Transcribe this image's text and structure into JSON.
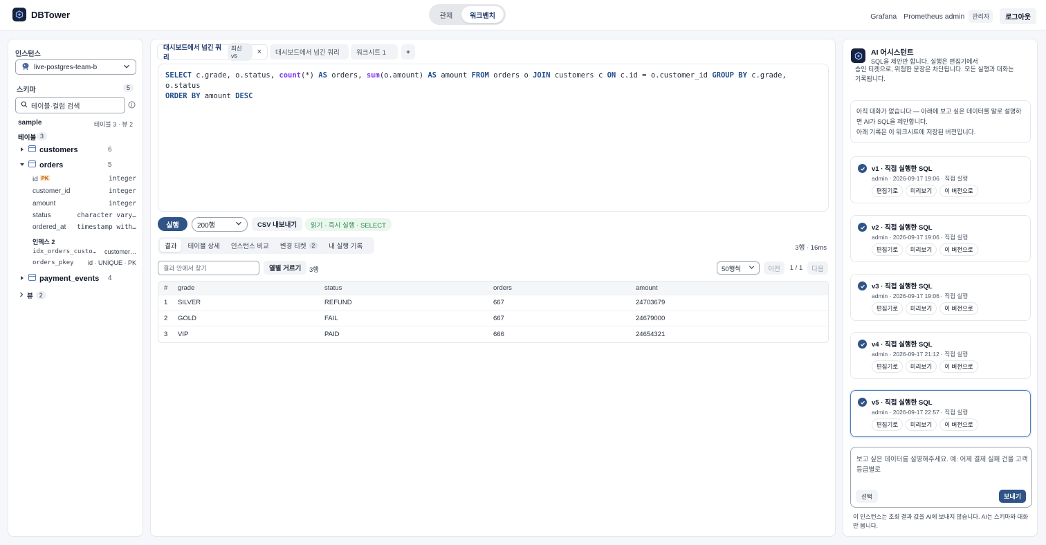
{
  "header": {
    "brand": "DBTower",
    "nav": [
      "관제",
      "워크벤치"
    ],
    "links": [
      "Grafana",
      "Prometheus admin"
    ],
    "role": "관리자",
    "logout": "로그아웃"
  },
  "left": {
    "instance_label": "인스턴스",
    "instance_value": "live-postgres-team-b",
    "schema_label": "스키마",
    "schema_count": "5",
    "search_placeholder": "테이블·컬럼 검색",
    "schema_name": "sample",
    "schema_meta": "테이블 3 · 뷰 2",
    "tables_label": "테이블",
    "tables_count": "3",
    "tables": [
      {
        "name": "customers",
        "count": "6"
      },
      {
        "name": "orders",
        "count": "5"
      },
      {
        "name": "payment_events",
        "count": "4"
      }
    ],
    "columns": [
      {
        "name": "id",
        "type": "integer",
        "pk": "PK"
      },
      {
        "name": "customer_id",
        "type": "integer"
      },
      {
        "name": "amount",
        "type": "integer"
      },
      {
        "name": "status",
        "type": "character vary…"
      },
      {
        "name": "ordered_at",
        "type": "timestamp with…"
      }
    ],
    "index_label": "인덱스 2",
    "indexes": [
      {
        "name": "idx_orders_custo…",
        "info": "customer…"
      },
      {
        "name": "orders_pkey",
        "info": "id · UNIQUE · PK"
      }
    ],
    "views_label": "뷰",
    "views_count": "2"
  },
  "center": {
    "tabs": [
      {
        "label": "대시보드에서 넘긴 쿼리",
        "badge": "최신 v5",
        "close": "×"
      },
      {
        "label": "대시보드에서 넘긴 쿼리"
      },
      {
        "label": "워크시트 1"
      }
    ],
    "add_tab": "+",
    "sql": {
      "t1": "SELECT",
      "t2": " c.grade, o.status, ",
      "t3": "count",
      "t4": "(*) ",
      "t5": "AS",
      "t6": " orders, ",
      "t7": "sum",
      "t8": "(o.amount) ",
      "t9": "AS",
      "t10": " amount ",
      "t11": "FROM",
      "t12": " orders o ",
      "t13": "JOIN",
      "t14": " customers c ",
      "t15": "ON",
      "t16": " c.id = o.customer_id ",
      "t17": "GROUP BY",
      "t18": " c.grade, o.status\n",
      "t19": "ORDER BY",
      "t20": " amount ",
      "t21": "DESC"
    },
    "run": "실행",
    "rows_limit": "200행",
    "csv": "CSV 내보내기",
    "read_badge": "읽기 · 즉시 실행 · SELECT",
    "subtabs": [
      "결과",
      "테이블 상세",
      "인스턴스 비교",
      "변경 티켓",
      "내 실행 기록"
    ],
    "ticket_count": "2",
    "timing": "3행 · 16ms",
    "filter_placeholder": "결과 안에서 찾기",
    "col_filter": "열별 거르기",
    "row_count": "3행",
    "page_size": "50행씩",
    "prev": "이전",
    "page": "1 / 1",
    "next": "다음",
    "columns": [
      "#",
      "grade",
      "status",
      "orders",
      "amount"
    ],
    "rows": [
      [
        "1",
        "SILVER",
        "REFUND",
        "667",
        "24703679"
      ],
      [
        "2",
        "GOLD",
        "FAIL",
        "667",
        "24679000"
      ],
      [
        "3",
        "VIP",
        "PAID",
        "666",
        "24654321"
      ]
    ]
  },
  "ai": {
    "title": "AI 어시스턴트",
    "subtitle": "SQL을 제안만 합니다. 실행은 편집기에서",
    "cut_line1": "승인 티켓으로, 위험한 문장은 차단됩니다. 모든 실행과 대화는",
    "cut_line2": "기록됩니다.",
    "empty_line1": "아직 대화가 없습니다 — 아래에 보고 싶은 데이터를 말로 설명하",
    "empty_line2": "면 AI가 SQL을 제안합니다.",
    "empty_line3": "아래 기록은 이 워크시트에 저장된 버전입니다.",
    "versions": [
      {
        "title": "v1 · 직접 실행한 SQL",
        "meta": "admin · 2026-09-17 19:06 · 직접 실행"
      },
      {
        "title": "v2 · 직접 실행한 SQL",
        "meta": "admin · 2026-09-17 19:06 · 직접 실행"
      },
      {
        "title": "v3 · 직접 실행한 SQL",
        "meta": "admin · 2026-09-17 19:06 · 직접 실행"
      },
      {
        "title": "v4 · 직접 실행한 SQL",
        "meta": "admin · 2026-09-17 21:12 · 직접 실행"
      },
      {
        "title": "v5 · 직접 실행한 SQL",
        "meta": "admin · 2026-09-17 22:57 · 직접 실행"
      }
    ],
    "version_buttons": [
      "편집기로",
      "미리보기",
      "이 버전으로"
    ],
    "chat_placeholder": "보고 싶은 데이터를 설명해주세요. 예: 어제 결제 실패 건을 고객 등급별로",
    "select": "선택",
    "send": "보내기",
    "footnote": "이 인스턴스는 조회 결과 값을 AI에 보내지 않습니다. AI는 스키마와 대화만 봅니다."
  },
  "colors": {
    "accent": "#2f5485",
    "success": "#2f8a4d",
    "keyword": "#1e4d8c",
    "function": "#7c3aed"
  }
}
